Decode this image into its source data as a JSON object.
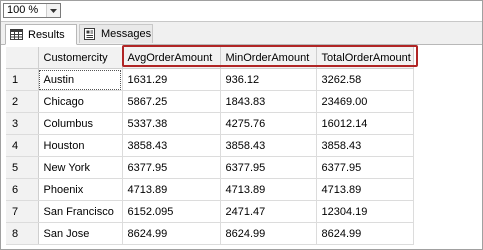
{
  "toolbar": {
    "zoom_value": "100 %"
  },
  "tabs": [
    {
      "label": "Results",
      "icon": "grid-icon"
    },
    {
      "label": "Messages",
      "icon": "messages-icon"
    }
  ],
  "grid": {
    "columns": [
      "Customercity",
      "AvgOrderAmount",
      "MinOrderAmount",
      "TotalOrderAmount"
    ],
    "rows": [
      {
        "num": "1",
        "cells": [
          "Austin",
          "1631.29",
          "936.12",
          "3262.58"
        ]
      },
      {
        "num": "2",
        "cells": [
          "Chicago",
          "5867.25",
          "1843.83",
          "23469.00"
        ]
      },
      {
        "num": "3",
        "cells": [
          "Columbus",
          "5337.38",
          "4275.76",
          "16012.14"
        ]
      },
      {
        "num": "4",
        "cells": [
          "Houston",
          "3858.43",
          "3858.43",
          "3858.43"
        ]
      },
      {
        "num": "5",
        "cells": [
          "New York",
          "6377.95",
          "6377.95",
          "6377.95"
        ]
      },
      {
        "num": "6",
        "cells": [
          "Phoenix",
          "4713.89",
          "4713.89",
          "4713.89"
        ]
      },
      {
        "num": "7",
        "cells": [
          "San Francisco",
          "6152.095",
          "2471.47",
          "12304.19"
        ]
      },
      {
        "num": "8",
        "cells": [
          "San Jose",
          "8624.99",
          "8624.99",
          "8624.99"
        ]
      }
    ],
    "selected_cell": {
      "row": 0,
      "col": 0
    }
  },
  "colors": {
    "highlight_border": "#b02525",
    "header_bg": "#f2f2f2",
    "grid_line": "#dcdcdc"
  }
}
